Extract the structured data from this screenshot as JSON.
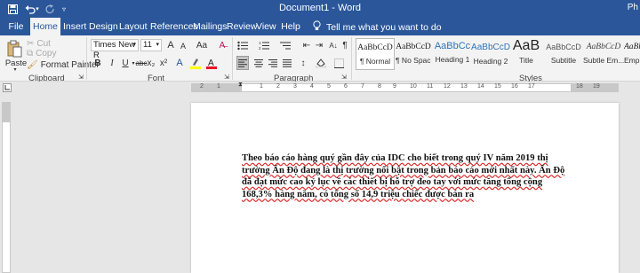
{
  "quick_access": {
    "save_icon": "save-icon",
    "undo_icon": "undo-icon",
    "redo_icon": "redo-icon",
    "customize_icon": "customize-qat-icon"
  },
  "title": "Document1 - Word",
  "user": "Ph",
  "tabs": [
    "File",
    "Home",
    "Insert",
    "Design",
    "Layout",
    "References",
    "Mailings",
    "Review",
    "View",
    "Help"
  ],
  "tell_me": "Tell me what you want to do",
  "clipboard": {
    "paste": "Paste",
    "cut": "Cut",
    "copy": "Copy",
    "format_painter": "Format Painter",
    "label": "Clipboard"
  },
  "font": {
    "name": "Times New R",
    "size": "11",
    "label": "Font",
    "grow": "A",
    "shrink": "A",
    "case": "Aa",
    "bold": "B",
    "italic": "I",
    "underline": "U",
    "strike": "abc",
    "subscript": "x₂",
    "superscript": "x²"
  },
  "paragraph": {
    "label": "Paragraph",
    "show_marks": "¶"
  },
  "styles": {
    "label": "Styles",
    "items": [
      {
        "preview": "AaBbCcD",
        "label": "¶ Normal"
      },
      {
        "preview": "AaBbCcD",
        "label": "¶ No Spac..."
      },
      {
        "preview": "AaBbCc",
        "label": "Heading 1"
      },
      {
        "preview": "AaBbCcD",
        "label": "Heading 2"
      },
      {
        "preview": "AaB",
        "label": "Title"
      },
      {
        "preview": "AaBbCcD",
        "label": "Subtitle"
      },
      {
        "preview": "AaBbCcD",
        "label": "Subtle Em..."
      },
      {
        "preview": "AaBbCcD",
        "label": "Emph"
      }
    ]
  },
  "ruler": {
    "numbers": [
      "2",
      "1",
      "1",
      "2",
      "3",
      "4",
      "5",
      "6",
      "7",
      "8",
      "9",
      "10",
      "11",
      "12",
      "13",
      "14",
      "15",
      "16",
      "17",
      "18",
      "19"
    ]
  },
  "document": {
    "text": "Theo báo cáo hàng quý gần đây của IDC cho biết trong quý IV năm 2019 thị trường Ấn Độ đang là thị trường nổi bật trong bản báo cáo mới nhất này. Ấn Độ đã đạt mức cao kỷ lục về các thiết bị hỗ trợ đeo tay với mức tăng tổng cộng 168,3% hàng năm, có tổng số 14,9 triệu chiếc được bán ra"
  },
  "colors": {
    "brand": "#2b579a",
    "ribbon_bg": "#f3f3f3",
    "canvas_bg": "#e6e6e6",
    "highlight": "#ffff00",
    "font_color": "#e81123",
    "spell_underline": "#d22222"
  }
}
